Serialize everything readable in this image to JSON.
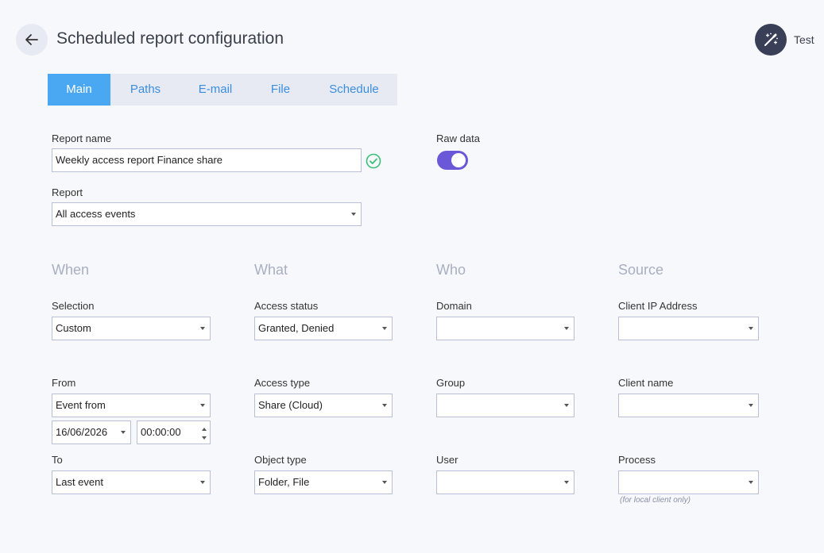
{
  "header": {
    "title": "Scheduled report configuration",
    "test_label": "Test",
    "back_icon": "arrow-left-icon",
    "test_icon": "magic-wand-icon"
  },
  "tabs": [
    {
      "label": "Main",
      "active": true
    },
    {
      "label": "Paths",
      "active": false
    },
    {
      "label": "E-mail",
      "active": false
    },
    {
      "label": "File",
      "active": false
    },
    {
      "label": "Schedule",
      "active": false
    }
  ],
  "main": {
    "report_name_label": "Report name",
    "report_name_value": "Weekly access report Finance share",
    "report_label": "Report",
    "report_value": "All access events",
    "raw_data_label": "Raw data",
    "raw_data_on": true
  },
  "sections": {
    "when": "When",
    "what": "What",
    "who": "Who",
    "source": "Source"
  },
  "when": {
    "selection_label": "Selection",
    "selection_value": "Custom",
    "from_label": "From",
    "from_value": "Event from",
    "from_date": "16/06/2026",
    "from_time": "00:00:00",
    "to_label": "To",
    "to_value": "Last event"
  },
  "what": {
    "access_status_label": "Access status",
    "access_status_value": "Granted, Denied",
    "access_type_label": "Access type",
    "access_type_value": "Share (Cloud)",
    "object_type_label": "Object type",
    "object_type_value": "Folder, File"
  },
  "who": {
    "domain_label": "Domain",
    "domain_value": "",
    "group_label": "Group",
    "group_value": "",
    "user_label": "User",
    "user_value": ""
  },
  "source": {
    "client_ip_label": "Client IP Address",
    "client_ip_value": "",
    "client_name_label": "Client name",
    "client_name_value": "",
    "process_label": "Process",
    "process_value": "",
    "process_hint": "(for local client only)"
  },
  "colors": {
    "accent_tab": "#4aa8f2",
    "toggle": "#6a58d8",
    "valid_check": "#3cbf7a"
  }
}
